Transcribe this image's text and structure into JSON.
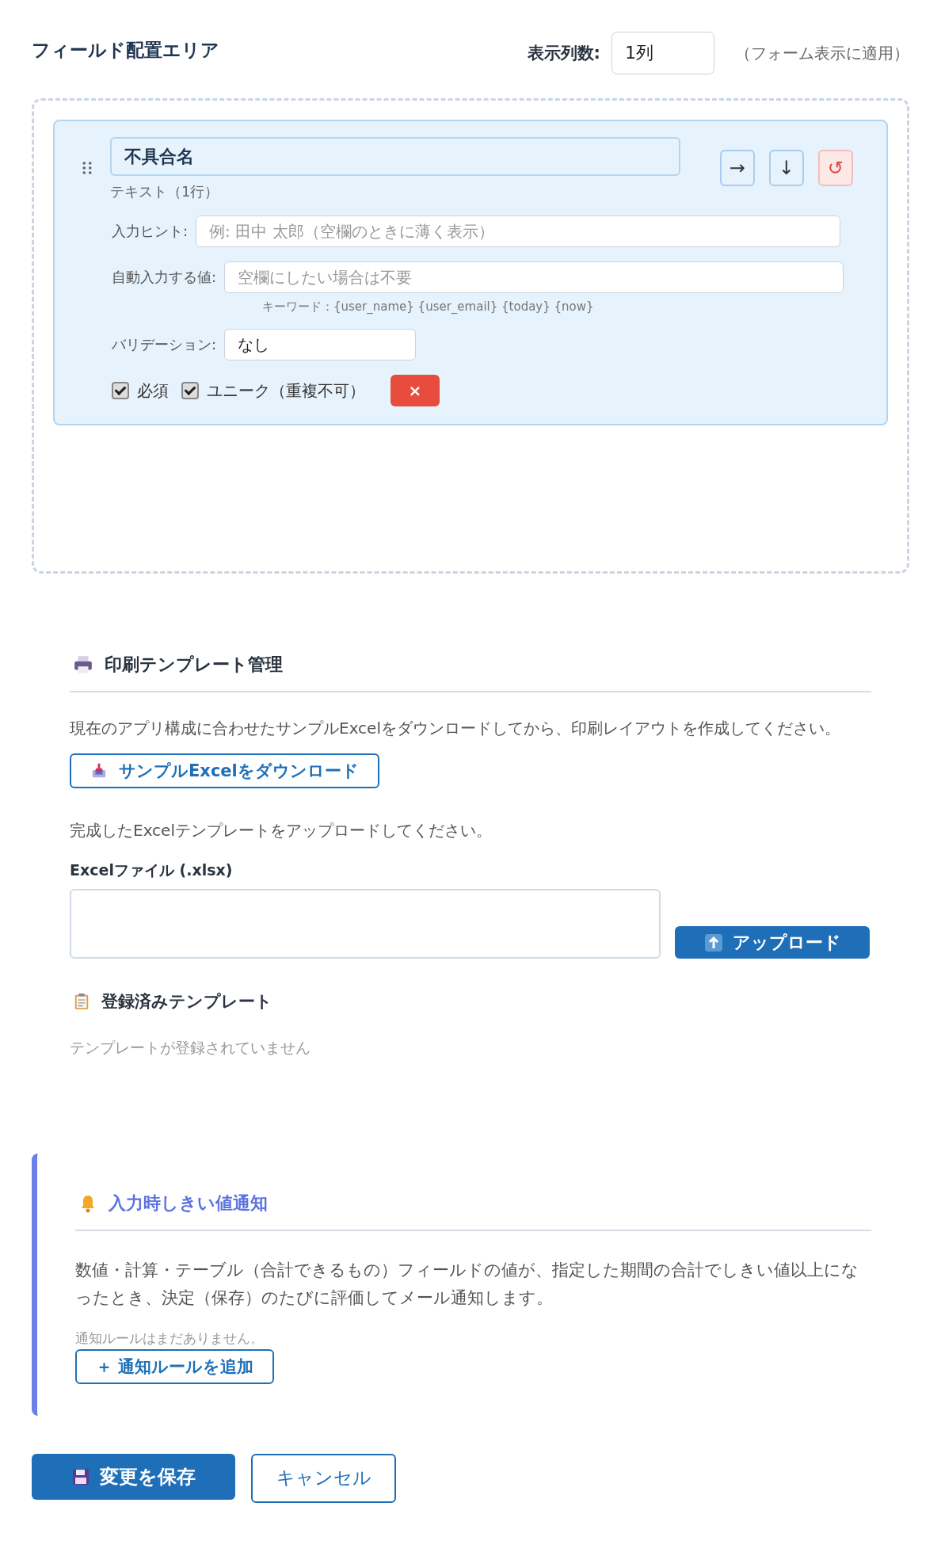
{
  "field_area": {
    "title": "フィールド配置エリア",
    "columns_label": "表示列数:",
    "columns_value": "1列",
    "columns_note": "（フォーム表示に適用）",
    "fields": [
      {
        "name": "不具合名",
        "type": "テキスト（1行）",
        "move_buttons": [
          {
            "symbol": "→",
            "kind": "move"
          },
          {
            "symbol": "↓",
            "kind": "move"
          },
          {
            "symbol": "↺",
            "kind": "reset"
          }
        ],
        "hint_label": "入力ヒント:",
        "hint_placeholder": "例: 田中 太郎（空欄のときに薄く表示）",
        "default_label": "自動入力する値:",
        "default_placeholder": "空欄にしたい場合は不要",
        "keywords": "キーワード：{user_name} {user_email} {today} {now}",
        "validation_label": "バリデーション:",
        "validation_value": "なし",
        "options": [
          {
            "label": "必須",
            "checked": true
          },
          {
            "label": "ユニーク（重複不可）",
            "checked": true
          }
        ],
        "delete_symbol": "×"
      }
    ]
  },
  "print_templates": {
    "title": "印刷テンプレート管理",
    "description": "現在のアプリ構成に合わせたサンプルExcelをダウンロードしてから、印刷レイアウトを作成してください。",
    "download_button": "サンプルExcelをダウンロード",
    "upload_description": "完成したExcelテンプレートをアップロードしてください。",
    "file_label": "Excelファイル (.xlsx)",
    "upload_button": "アップロード",
    "registered_title": "登録済みテンプレート",
    "empty_text": "テンプレートが登録されていません"
  },
  "threshold_notice": {
    "title": "入力時しきい値通知",
    "description": "数値・計算・テーブル（合計できるもの）フィールドの値が、指定した期間の合計でしきい値以上になったとき、決定（保存）のたびに評価してメール通知します。",
    "empty_text": "通知ルールはまだありません。",
    "add_button": "＋ 通知ルールを追加"
  },
  "actions": {
    "save_button": "変更を保存",
    "cancel_button": "キャンセル"
  }
}
